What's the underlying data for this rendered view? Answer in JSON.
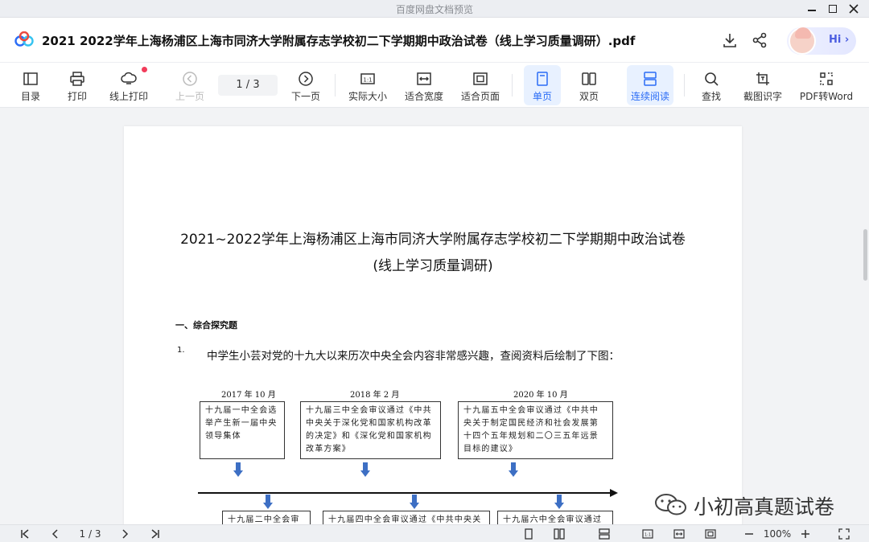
{
  "window": {
    "title": "百度网盘文档预览"
  },
  "header": {
    "doc_title": "2021  2022学年上海杨浦区上海市同济大学附属存志学校初二下学期期中政治试卷（线上学习质量调研）.pdf",
    "assistant_label": "Hi ›"
  },
  "toolbar": {
    "toc": "目录",
    "print": "打印",
    "online_print": "线上打印",
    "prev_page": "上一页",
    "page_indicator": "1 / 3",
    "next_page": "下一页",
    "actual_size": "实际大小",
    "fit_width": "适合宽度",
    "fit_page": "适合页面",
    "single_page": "单页",
    "double_page": "双页",
    "continuous": "连续阅读",
    "find": "查找",
    "screenshot_ocr": "截图识字",
    "pdf_to_word": "PDF转Word"
  },
  "document": {
    "title_line1": "2021~2022学年上海杨浦区上海市同济大学附属存志学校初二下学期期中政治试卷",
    "title_line2": "(线上学习质量调研)",
    "section": "一、综合探究题",
    "question_number": "1.",
    "question_text": "中学生小芸对党的十九大以来历次中央全会内容非常感兴趣，查阅资料后绘制了下图：",
    "diagram": {
      "years": [
        "2017 年 10 月",
        "2018 年 2 月",
        "2020 年 10 月"
      ],
      "top_boxes": [
        "十九届一中全会选举产生新一届中央领导集体",
        "十九届三中全会审议通过《中共中央关于深化党和国家机构改革的决定》和《深化党和国家机构改革方案》",
        "十九届五中全会审议通过《中共中央关于制定国民经济和社会发展第十四个五年规划和二〇三五年远景目标的建议》"
      ],
      "bottom_boxes": [
        "十九届二中全会审议通过《中共中央",
        "十九届四中全会审议通过《中共中央关于坚持和完善中国特色社会主义制",
        "十九届六中全会审议通过《中共中央关于党的百"
      ]
    }
  },
  "watermark": {
    "text": "小初高真题试卷"
  },
  "bottombar": {
    "page_indicator": "1 / 3",
    "zoom": "100%"
  },
  "colors": {
    "accent": "#2a6cf6",
    "active_bg": "#e8f1ff",
    "notification": "#f23c5b",
    "diagram_arrow": "#3d6fc4"
  }
}
